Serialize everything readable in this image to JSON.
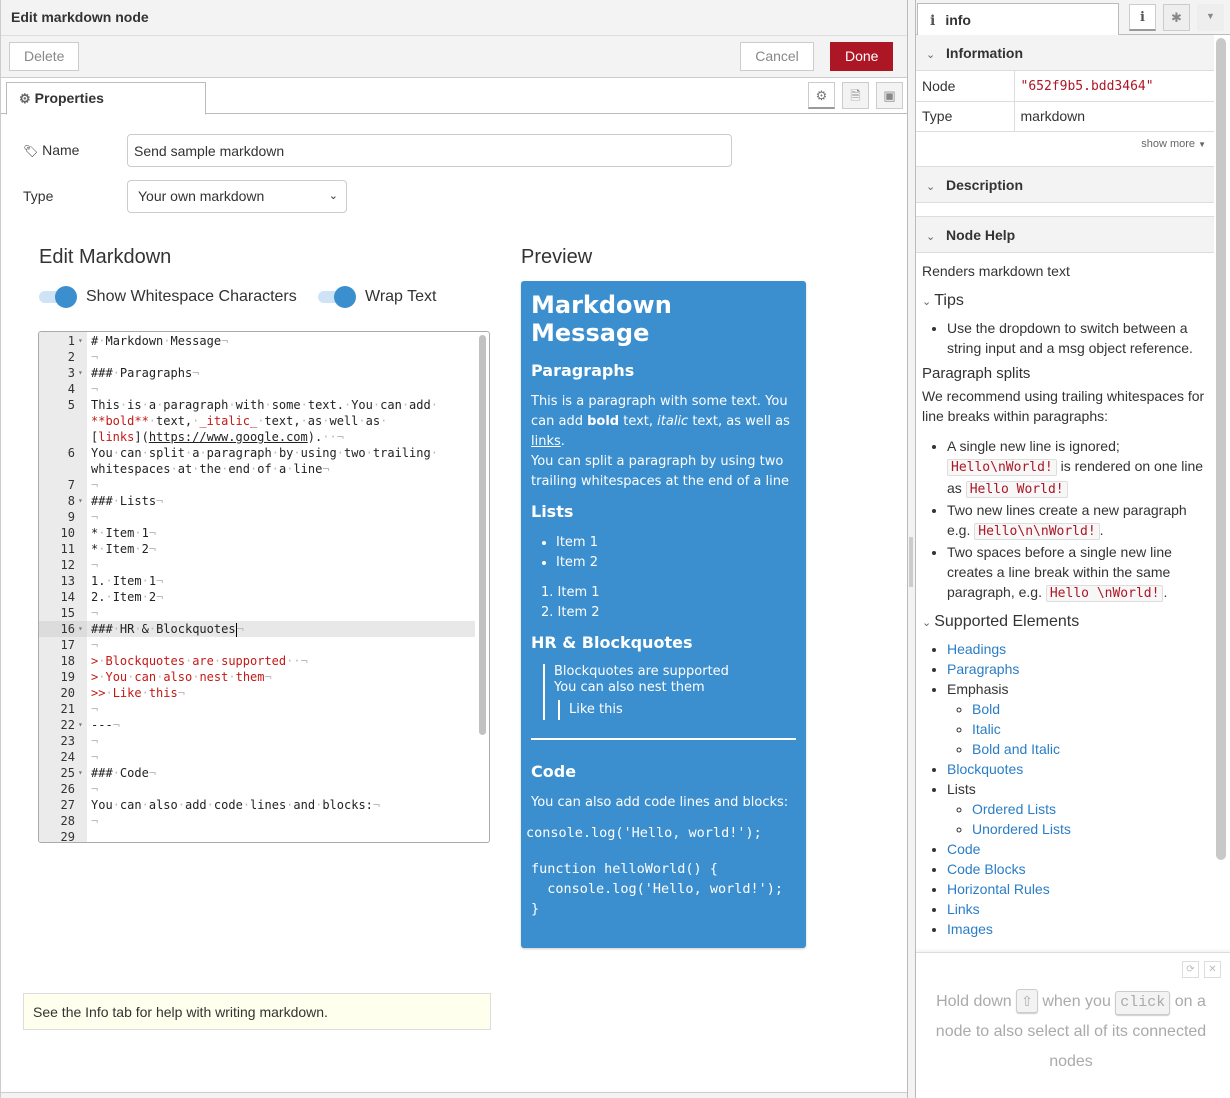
{
  "tray": {
    "title": "Edit markdown node",
    "delete_label": "Delete",
    "cancel_label": "Cancel",
    "done_label": "Done",
    "tab_label": "Properties"
  },
  "form": {
    "name_label": "Name",
    "name_value": "Send sample markdown",
    "type_label": "Type",
    "type_value": "Your own markdown"
  },
  "editor": {
    "title": "Edit Markdown",
    "toggle_whitespace_label": "Show Whitespace Characters",
    "toggle_wrap_label": "Wrap Text",
    "toggle_whitespace_on": true,
    "toggle_wrap_on": true,
    "active_line": 16,
    "lines": [
      {
        "n": "1",
        "fold": true,
        "text": "# Markdown Message"
      },
      {
        "n": "2",
        "text": ""
      },
      {
        "n": "3",
        "fold": true,
        "text": "### Paragraphs"
      },
      {
        "n": "4",
        "text": ""
      },
      {
        "n": "5",
        "text": "This is a paragraph with some text. You can add"
      },
      {
        "n": "",
        "text": "**bold** text, _italic_ text, as well as",
        "red_prefix": true
      },
      {
        "n": "",
        "text": "[links](https://www.google.com).  "
      },
      {
        "n": "6",
        "text": "You can split a paragraph by using two trailing"
      },
      {
        "n": "",
        "text": "whitespaces at the end of a line"
      },
      {
        "n": "7",
        "text": ""
      },
      {
        "n": "8",
        "fold": true,
        "text": "### Lists"
      },
      {
        "n": "9",
        "text": ""
      },
      {
        "n": "10",
        "text": "* Item 1"
      },
      {
        "n": "11",
        "text": "* Item 2"
      },
      {
        "n": "12",
        "text": ""
      },
      {
        "n": "13",
        "text": "1. Item 1"
      },
      {
        "n": "14",
        "text": "2. Item 2"
      },
      {
        "n": "15",
        "text": ""
      },
      {
        "n": "16",
        "fold": true,
        "text": "### HR & Blockquotes",
        "active": true
      },
      {
        "n": "17",
        "text": ""
      },
      {
        "n": "18",
        "text": "> Blockquotes are supported  ",
        "red": true
      },
      {
        "n": "19",
        "text": "> You can also nest them",
        "red": true
      },
      {
        "n": "20",
        "text": ">> Like this",
        "red": true
      },
      {
        "n": "21",
        "text": ""
      },
      {
        "n": "22",
        "fold": true,
        "text": "---"
      },
      {
        "n": "23",
        "text": ""
      },
      {
        "n": "24",
        "text": ""
      },
      {
        "n": "25",
        "fold": true,
        "text": "### Code"
      },
      {
        "n": "26",
        "text": ""
      },
      {
        "n": "27",
        "text": "You can also add code lines and blocks:"
      },
      {
        "n": "28",
        "text": ""
      },
      {
        "n": "29",
        "text": "",
        "no_eol": true
      }
    ]
  },
  "preview": {
    "title": "Preview",
    "h1": "Markdown Message",
    "h_paragraphs": "Paragraphs",
    "p1_a": "This is a paragraph with some text. You can add ",
    "p1_bold": "bold",
    "p1_b": " text, ",
    "p1_italic": "italic",
    "p1_c": " text, as well as ",
    "p1_link": "links",
    "p1_d": ".",
    "p1_line2": "You can split a paragraph by using two trailing whitespaces at the end of a line",
    "h_lists": "Lists",
    "ul": [
      "Item 1",
      "Item 2"
    ],
    "ol": [
      "Item 1",
      "Item 2"
    ],
    "h_hr": "HR & Blockquotes",
    "bq1": "Blockquotes are supported",
    "bq2": "You can also nest them",
    "bq_nested": "Like this",
    "h_code": "Code",
    "code_intro": "You can also add code lines and blocks:",
    "code_inline": "console.log('Hello, world!');",
    "code_block": "function helloWorld() {\n  console.log('Hello, world!');\n}",
    "bg_color": "#3b8fcf"
  },
  "tip_box": "See the Info tab for help with writing markdown.",
  "sidebar": {
    "tab_label": "info",
    "info_section": "Information",
    "node_label": "Node",
    "node_value": "\"652f9b5.bdd3464\"",
    "type_label": "Type",
    "type_value": "markdown",
    "show_more": "show more",
    "description_section": "Description",
    "help_section": "Node Help",
    "help_intro": "Renders markdown text",
    "tips_title": "Tips",
    "tips_items": [
      "Use the dropdown to switch between a string input and a msg object reference."
    ],
    "para_title": "Paragraph splits",
    "para_text": "We recommend using trailing whitespaces for line breaks within paragraphs:",
    "para_items": [
      {
        "a": "A single new line is ignored; ",
        "code1": "Hello\\nWorld!",
        "b": " is rendered on one line as ",
        "code2": "Hello World!",
        "c": ""
      },
      {
        "a": "Two new lines create a new paragraph e.g. ",
        "code1": "Hello\\n\\nWorld!",
        "b": ".",
        "code2": "",
        "c": ""
      },
      {
        "a": "Two spaces before a single new line creates a line break within the same paragraph, e.g. ",
        "code1": "Hello \\nWorld!",
        "b": ".",
        "code2": "",
        "c": ""
      }
    ],
    "supported_title": "Supported Elements",
    "supported": {
      "headings": "Headings",
      "paragraphs": "Paragraphs",
      "emphasis": "Emphasis",
      "bold": "Bold",
      "italic": "Italic",
      "bold_italic": "Bold and Italic",
      "blockquotes": "Blockquotes",
      "lists": "Lists",
      "ordered": "Ordered Lists",
      "unordered": "Unordered Lists",
      "code": "Code",
      "code_blocks": "Code Blocks",
      "hr": "Horizontal Rules",
      "links": "Links",
      "images": "Images"
    },
    "tip": {
      "a": "Hold down",
      "key": "⇧",
      "b": "when you",
      "click": "click",
      "c": "on a node to also select all of its connected nodes"
    }
  }
}
